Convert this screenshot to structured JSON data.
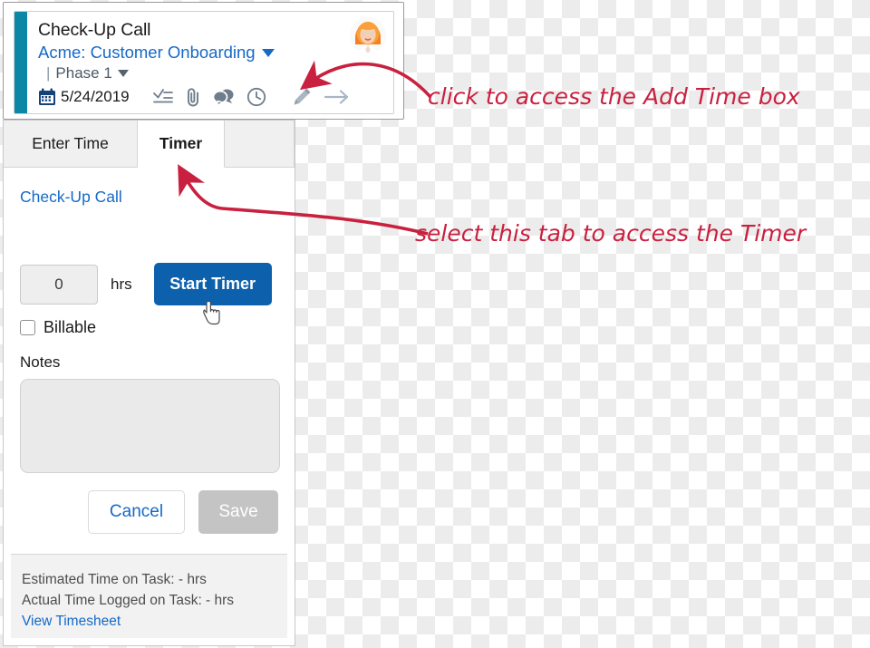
{
  "task_card": {
    "title": "Check-Up Call",
    "project": "Acme: Customer Onboarding",
    "phase_separator": "|",
    "phase": "Phase 1",
    "date": "5/24/2019",
    "icons": [
      "checklist-icon",
      "paperclip-icon",
      "comment-icon",
      "clock-icon"
    ],
    "actions": [
      "pencil-icon",
      "arrow-right-icon"
    ],
    "avatar": "user-avatar",
    "accent_color": "#0c86a5",
    "link_color": "#1569c7"
  },
  "time_panel": {
    "tabs": [
      {
        "label": "Enter Time",
        "active": false
      },
      {
        "label": "Timer",
        "active": true
      }
    ],
    "entity_link": "Check-Up Call",
    "hours_value": "0",
    "hours_unit": "hrs",
    "start_timer_label": "Start Timer",
    "billable_label": "Billable",
    "billable_checked": false,
    "notes_label": "Notes",
    "notes_value": "",
    "cancel_label": "Cancel",
    "save_label": "Save",
    "footer": {
      "estimated": "Estimated Time on Task: - hrs",
      "actual": "Actual Time Logged on Task: - hrs",
      "timesheet_link": "View Timesheet"
    }
  },
  "annotations": {
    "color": "#c9203f",
    "items": [
      {
        "text": "click to access the Add Time box",
        "target": "clock-icon"
      },
      {
        "text": "select this tab to access the Timer",
        "target": "timer-tab"
      }
    ]
  }
}
